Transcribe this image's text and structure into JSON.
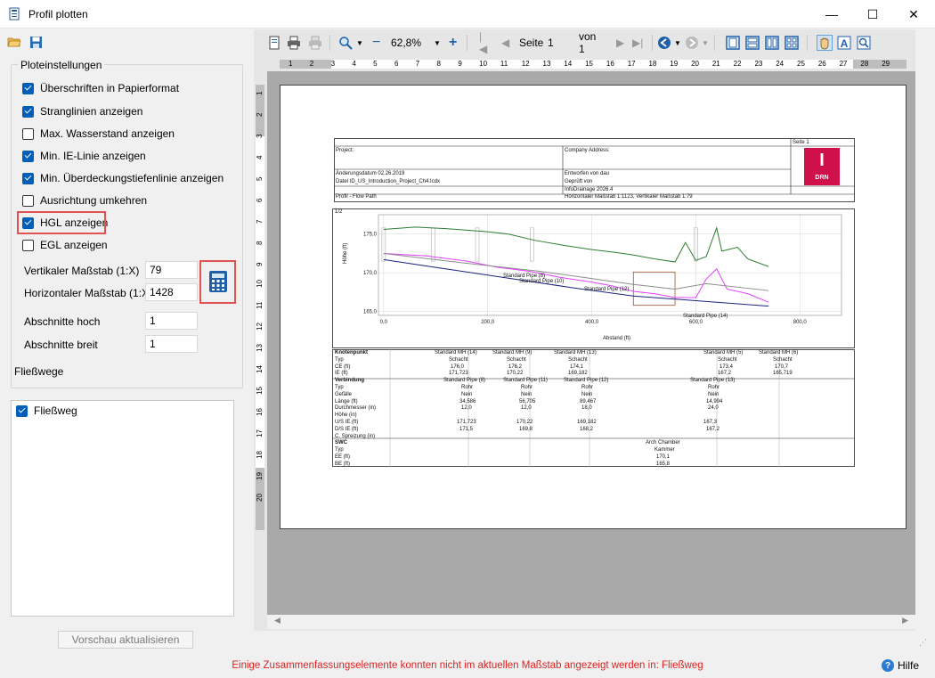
{
  "window": {
    "title": "Profil plotten",
    "minimize": "—",
    "maximize": "☐",
    "close": "✕"
  },
  "settings": {
    "group_title": "Ploteinstellungen",
    "checkboxes": [
      {
        "label": "Überschriften in Papierformat",
        "checked": true
      },
      {
        "label": "Stranglinien anzeigen",
        "checked": true
      },
      {
        "label": "Max. Wasserstand anzeigen",
        "checked": false
      },
      {
        "label": "Min. IE-Linie anzeigen",
        "checked": true
      },
      {
        "label": "Min. Überdeckungstiefenlinie anzeigen",
        "checked": true
      },
      {
        "label": "Ausrichtung umkehren",
        "checked": false
      },
      {
        "label": "HGL anzeigen",
        "checked": true
      },
      {
        "label": "EGL anzeigen",
        "checked": false
      }
    ],
    "vertical_scale_label": "Vertikaler Maßstab (1:X)",
    "vertical_scale_value": "79",
    "horizontal_scale_label": "Horizontaler Maßstab (1:X)",
    "horizontal_scale_value": "1428",
    "sections_high_label": "Abschnitte hoch",
    "sections_high_value": "1",
    "sections_wide_label": "Abschnitte breit",
    "sections_wide_value": "1"
  },
  "flowpaths": {
    "label": "Fließwege",
    "items": [
      {
        "label": "Fließweg",
        "checked": true
      }
    ]
  },
  "refresh_button": "Vorschau aktualisieren",
  "status_message": "Einige Zusammenfassungselemente konnten nicht im aktuellen Maßstab angezeigt werden in: Fließweg",
  "help_label": "Hilfe",
  "preview_toolbar": {
    "zoom": "62,8%",
    "page_label": "Seite",
    "page_value": "1",
    "of_label": "von 1"
  },
  "ruler": {
    "h_ticks": [
      "1",
      "2",
      "3",
      "4",
      "5",
      "6",
      "7",
      "8",
      "9",
      "10",
      "11",
      "12",
      "13",
      "14",
      "15",
      "16",
      "17",
      "18",
      "19",
      "20",
      "21",
      "22",
      "23",
      "24",
      "25",
      "26",
      "27",
      "28",
      "29"
    ],
    "v_ticks": [
      "1",
      "2",
      "3",
      "4",
      "5",
      "6",
      "7",
      "8",
      "9",
      "10",
      "11",
      "12",
      "13",
      "14",
      "15",
      "16",
      "17",
      "18",
      "19",
      "20"
    ]
  },
  "sheet": {
    "page_no": "Seite 1",
    "project": "Project:",
    "company": "Company Address:",
    "changed": "Änderungsdatum 02.26.2019",
    "file": "Datei ID_US_Introduction_Project_Ch4.Icdx",
    "designed": "Entworfen von dau",
    "checked": "Geprüft von",
    "software": "InfoDrainage 2026.4",
    "profile": "Profil - Flow Path",
    "scales": "Horizontaler Maßstab 1:1123, Vertikaler Maßstab 1:79",
    "logo_letter": "I",
    "logo_text": "DRN",
    "plot_index": "1/2",
    "y_label": "Höhe (ft)",
    "x_label": "Abstand (ft)",
    "pipe_labels": [
      "Standard Pipe (8)",
      "Standard Pipe (10)",
      "Standard Pipe (12)",
      "Standard Pipe (14)"
    ],
    "table_left": [
      "Knotenpunkt",
      "Typ",
      "CE (ft)",
      "IE (ft)",
      "Verbindung",
      "Typ",
      "Gefälle",
      "Länge (ft)",
      "Durchmesser (in)",
      "Höhe (in)",
      "U/S IE (ft)",
      "D/S IE (ft)",
      "C. Spreizung (in)",
      "SWC",
      "Typ",
      "EE (ft)",
      "BE (ft)"
    ],
    "node_cols": [
      {
        "name": "Standard MH (14)",
        "typ": "Schacht",
        "ce": "176,0",
        "ie": "171,723"
      },
      {
        "name": "Standard MH (9)",
        "typ": "Schacht",
        "ce": "176,2",
        "ie": "170,22"
      },
      {
        "name": "Standard MH (13)",
        "typ": "Schacht",
        "ce": "174,1",
        "ie": "169,182"
      },
      {
        "name": "Standard MH (5)",
        "typ": "Schacht",
        "ce": "173,4",
        "ie": "167,2"
      },
      {
        "name": "Standard MH (6)",
        "typ": "Schacht",
        "ce": "170,7",
        "ie": "165,719"
      }
    ],
    "link_cols": [
      {
        "name": "Standard Pipe (8)",
        "typ": "Rohr",
        "slope": "Nein",
        "len": "34,586",
        "dia": "12,0",
        "us": "171,723",
        "ds": "171,5"
      },
      {
        "name": "Standard Pipe (11)",
        "typ": "Rohr",
        "slope": "Nein",
        "len": "56,705",
        "dia": "12,0",
        "us": "170,22",
        "ds": "169,8"
      },
      {
        "name": "Standard Pipe (12)",
        "typ": "Rohr",
        "slope": "Nein",
        "len": "89,467",
        "dia": "18,0",
        "us": "169,182",
        "ds": "168,2"
      },
      {
        "name": "Standard Pipe (13)",
        "typ": "Rohr",
        "slope": "Nein",
        "len": "14,994",
        "dia": "24,0",
        "us": "167,3",
        "ds": "167,2"
      }
    ],
    "swc": {
      "name": "Arch Chamber",
      "typ": "Kammer",
      "ee": "170,1",
      "be": "165,8"
    }
  },
  "chart_data": {
    "type": "line",
    "title": "",
    "xlabel": "Abstand (ft)",
    "ylabel": "Höhe (ft)",
    "xlim": [
      -10,
      880
    ],
    "ylim": [
      164.5,
      177.5
    ],
    "x_ticks": [
      "0,0",
      "200,0",
      "400,0",
      "600,0",
      "800,0"
    ],
    "y_ticks": [
      "165,0",
      "170,0",
      "175,0"
    ],
    "grid": true,
    "legend": "none",
    "series": [
      {
        "color": "#2e7d32",
        "x": [
          0,
          60,
          120,
          200,
          240,
          290,
          350,
          400,
          450,
          480,
          520,
          560,
          580,
          600,
          620,
          640,
          650,
          680,
          700,
          740
        ],
        "y": [
          175.6,
          175.9,
          175.7,
          175.3,
          175.0,
          174.2,
          173.5,
          173.0,
          172.6,
          172.3,
          171.8,
          171.4,
          173.9,
          171.6,
          172.1,
          175.8,
          172.8,
          173.3,
          171.8,
          170.8
        ]
      },
      {
        "color": "#e040fb",
        "x": [
          0,
          80,
          160,
          220,
          280,
          340,
          400,
          440,
          480,
          520,
          560,
          600,
          620,
          640,
          660,
          700,
          740
        ],
        "y": [
          172.5,
          172.2,
          171.5,
          170.7,
          170.2,
          169.4,
          168.8,
          168.3,
          167.6,
          167.3,
          166.8,
          166.8,
          169.2,
          170.5,
          167.9,
          167.3,
          166.2
        ]
      },
      {
        "color": "#8c8c8c",
        "x": [
          0,
          150,
          300,
          480,
          560,
          620,
          740
        ],
        "y": [
          172.5,
          171.3,
          170.2,
          168.5,
          167.9,
          168.6,
          167.7
        ]
      },
      {
        "color": "#1a237e",
        "x": [
          0,
          120,
          240,
          360,
          480,
          600,
          740
        ],
        "y": [
          171.7,
          170.5,
          169.3,
          168.1,
          167.0,
          166.4,
          165.7
        ]
      }
    ]
  }
}
